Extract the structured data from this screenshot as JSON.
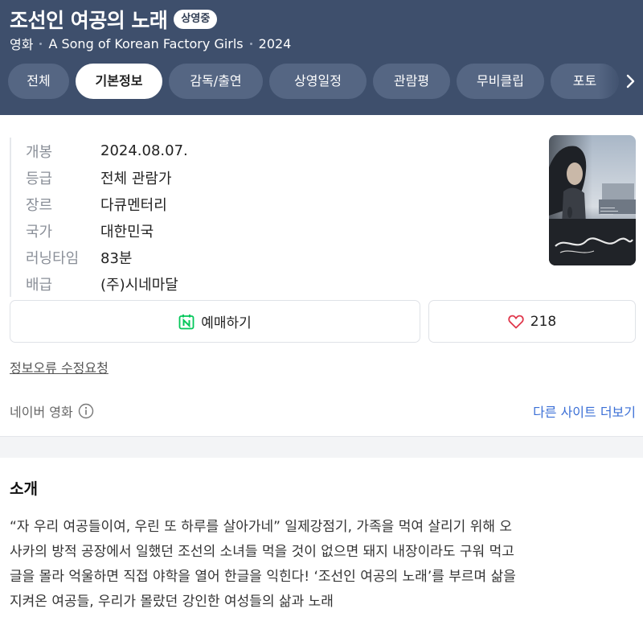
{
  "header": {
    "title": "조선인 여공의 노래",
    "status_badge": "상영중",
    "category": "영화",
    "english_title": "A Song of Korean Factory Girls",
    "year": "2024"
  },
  "tabs": [
    {
      "label": "전체",
      "active": false
    },
    {
      "label": "기본정보",
      "active": true
    },
    {
      "label": "감독/출연",
      "active": false
    },
    {
      "label": "상영일정",
      "active": false
    },
    {
      "label": "관람평",
      "active": false
    },
    {
      "label": "무비클립",
      "active": false
    },
    {
      "label": "포토",
      "active": false
    },
    {
      "label": "",
      "active": false
    }
  ],
  "info": [
    {
      "key": "개봉",
      "value": "2024.08.07."
    },
    {
      "key": "등급",
      "value": "전체 관람가"
    },
    {
      "key": "장르",
      "value": "다큐멘터리"
    },
    {
      "key": "국가",
      "value": "대한민국"
    },
    {
      "key": "러닝타임",
      "value": "83분"
    },
    {
      "key": "배급",
      "value": "(주)시네마달"
    }
  ],
  "actions": {
    "book_label": "예매하기",
    "like_count": "218"
  },
  "report_link": "정보오류 수정요청",
  "source": {
    "label": "네이버 영화",
    "more_link": "다른 사이트 더보기"
  },
  "intro": {
    "title": "소개",
    "lines": [
      "“자 우리 여공들이여, 우린 또 하루를 살아가네” 일제강점기, 가족을 먹여 살리기 위해 오",
      "사카의 방적 공장에서 일했던 조선의 소녀들 먹을 것이 없으면 돼지 내장이라도 구워 먹고",
      "글을 몰라 억울하면 직접 야학을 열어 한글을 익힌다! ‘조선인 여공의 노래’를 부르며 삶을",
      "지켜온 여공들, 우리가 몰랐던 강인한 여성들의 삶과 노래"
    ]
  },
  "colors": {
    "header_bg": "#3e4f6c",
    "tab_bg": "#556683",
    "link_blue": "#3b6fd6",
    "naver_green": "#03c75a",
    "heart_red": "#e0394d"
  }
}
